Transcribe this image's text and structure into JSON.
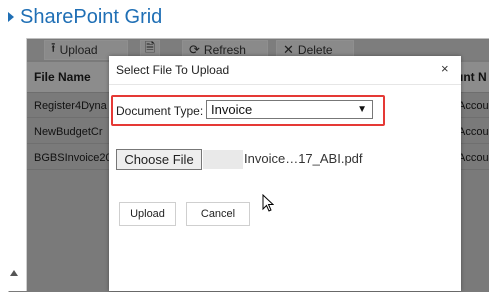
{
  "app": {
    "title": "SharePoint Grid"
  },
  "toolbar": {
    "upload_label": "Upload",
    "refresh_label": "Refresh",
    "delete_label": "Delete"
  },
  "grid": {
    "headers": {
      "file_name": "File Name",
      "right_partial": "unt N"
    },
    "rows": [
      {
        "file": "Register4Dyna",
        "right": "Accou"
      },
      {
        "file": "NewBudgetCr",
        "right": "Accou"
      },
      {
        "file": "BGBSInvoice20",
        "right": "Accou"
      }
    ]
  },
  "dialog": {
    "title": "Select File To Upload",
    "close_icon": "×",
    "document_type_label": "Document Type:",
    "document_type_value": "Invoice",
    "choose_file_label": "Choose File",
    "file_name": "Invoice…17_ABI.pdf",
    "upload_button": "Upload",
    "cancel_button": "Cancel"
  },
  "colors": {
    "title_blue": "#1f6fb5",
    "highlight_red": "#e53935",
    "overlay_gray": "#7a7a7a"
  }
}
